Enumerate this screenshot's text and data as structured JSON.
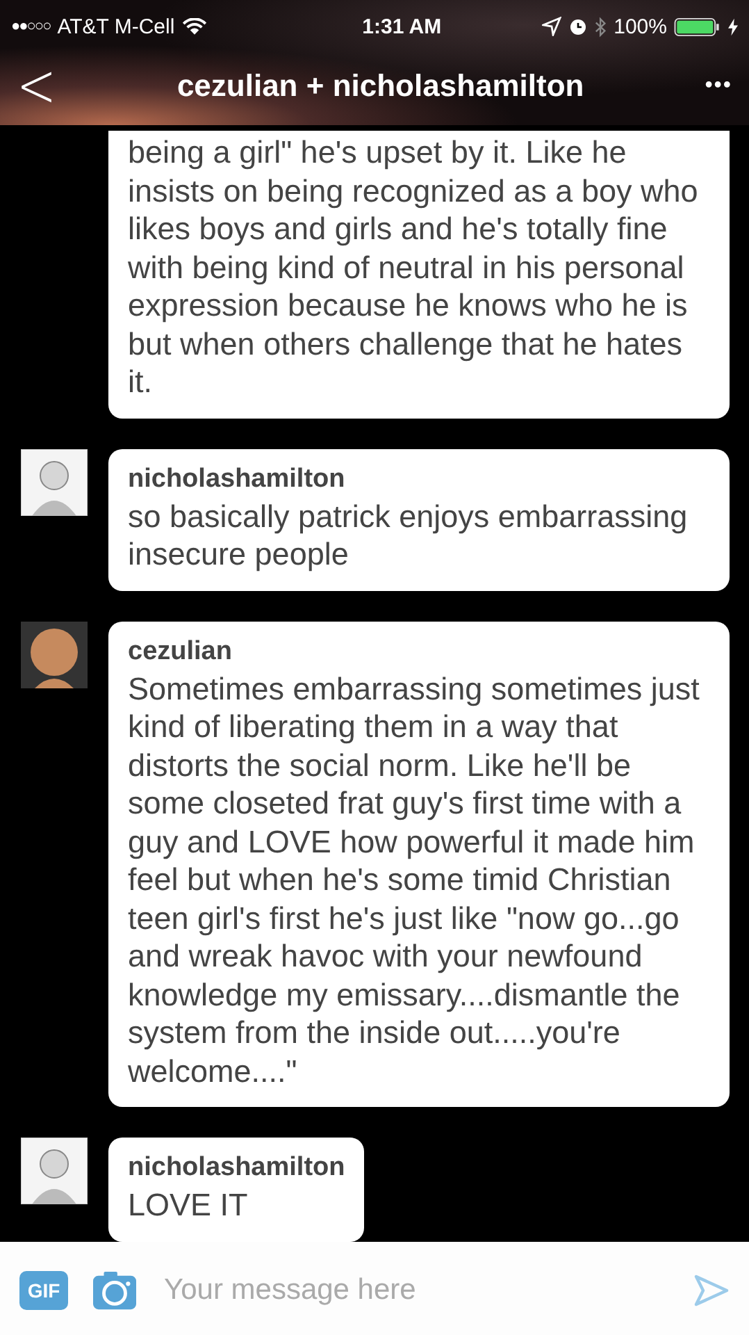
{
  "status_bar": {
    "signal": "●●○○○",
    "carrier": "AT&T M-Cell",
    "time": "1:31 AM",
    "battery": "100%"
  },
  "header": {
    "back": "<",
    "title": "cezulian + nicholashamilton",
    "more": "•••"
  },
  "messages": [
    {
      "kind": "continuation",
      "text": "being a girl\" he's upset by it. Like he insists on being recognized as a boy who likes boys and girls and he's totally fine with being kind of neutral in his personal expression because he knows who he is but when others challenge that he hates it."
    },
    {
      "kind": "sketch",
      "sender": "nicholashamilton",
      "text": "so basically patrick enjoys embarrassing insecure people"
    },
    {
      "kind": "cartoon",
      "sender": "cezulian",
      "text": "Sometimes embarrassing sometimes just kind of liberating them in a way that distorts the social norm. Like he'll be some closeted frat guy's first time with a guy and LOVE how powerful it made him feel but when he's some timid Christian teen girl's first he's just like \"now go...go and wreak havoc with your newfound knowledge my emissary....dismantle the system from the inside out.....you're welcome....\""
    },
    {
      "kind": "sketch",
      "sender": "nicholashamilton",
      "text": "LOVE IT"
    }
  ],
  "composer": {
    "gif": "GIF",
    "placeholder": "Your message here"
  }
}
